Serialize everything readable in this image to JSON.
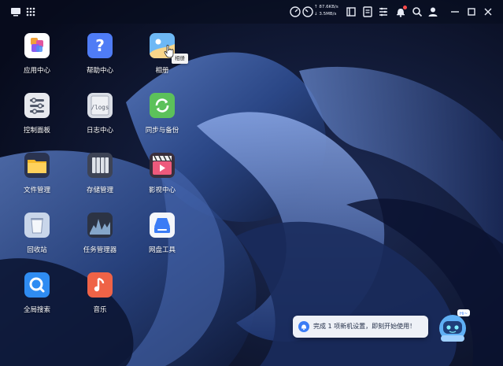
{
  "topbar": {
    "left_icons": [
      "desktop-icon",
      "grid-apps-icon"
    ],
    "net_upload": "↑ 87.6KB/s",
    "net_download": "↓ 3.5MB/s",
    "right_icons": [
      "resource-monitor-icon",
      "task-list-icon",
      "id-card-icon",
      "settings-panel-icon",
      "bell-icon",
      "search-icon",
      "user-icon",
      "minimize-icon",
      "maximize-icon",
      "close-icon"
    ],
    "notification_dot_color": "#ff4b4b"
  },
  "apps": [
    {
      "label": "应用中心",
      "icon": "app-center-icon"
    },
    {
      "label": "帮助中心",
      "icon": "help-icon"
    },
    {
      "label": "相册",
      "icon": "photo-album-icon"
    },
    {
      "label": "控制面板",
      "icon": "control-panel-icon"
    },
    {
      "label": "日志中心",
      "icon": "log-center-icon",
      "tile_text": "/logs"
    },
    {
      "label": "同步与备份",
      "icon": "sync-backup-icon"
    },
    {
      "label": "文件管理",
      "icon": "folder-icon"
    },
    {
      "label": "存储管理",
      "icon": "storage-icon"
    },
    {
      "label": "影视中心",
      "icon": "video-icon"
    },
    {
      "label": "回收站",
      "icon": "trash-icon"
    },
    {
      "label": "任务管理器",
      "icon": "task-manager-icon"
    },
    {
      "label": "网盘工具",
      "icon": "cloud-drive-icon"
    },
    {
      "label": "全局搜索",
      "icon": "global-search-icon"
    },
    {
      "label": "音乐",
      "icon": "music-icon"
    }
  ],
  "tooltip": "相册",
  "notification": {
    "text": "完成 1 项新机设置，即刻开始使用！"
  },
  "assistant": {
    "badge": "Hi~",
    "icon": "robot-assistant-icon"
  },
  "colors": {
    "wallpaper_dark": "#0d1530",
    "wallpaper_blue": "#3c5fa8",
    "notify_bg": "#eef1f7",
    "notify_accent": "#3b7cf5"
  }
}
